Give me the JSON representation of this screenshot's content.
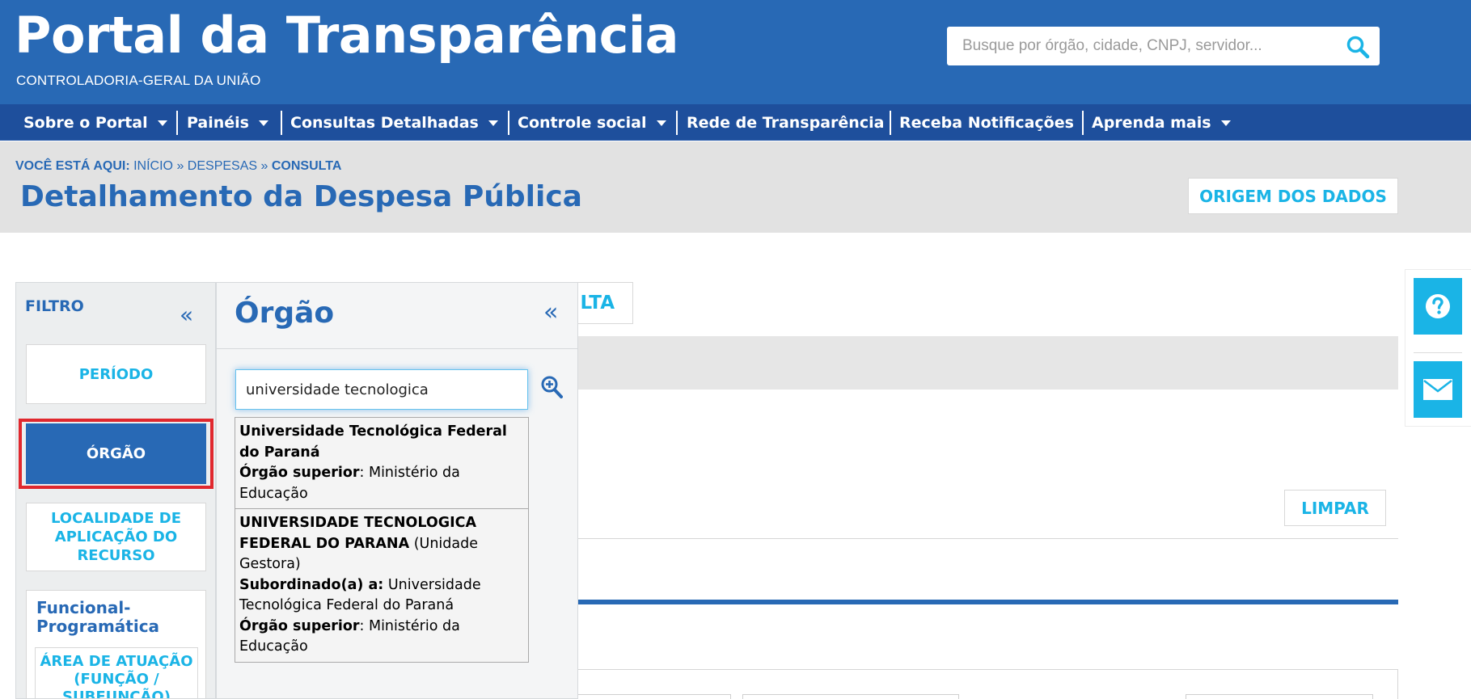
{
  "header": {
    "title": "Portal da Transparência",
    "subtitle": "CONTROLADORIA-GERAL DA UNIÃO",
    "search_placeholder": "Busque por órgão, cidade, CNPJ, servidor..."
  },
  "nav": {
    "items": [
      {
        "label": "Sobre o Portal",
        "dropdown": true
      },
      {
        "label": "Painéis",
        "dropdown": true
      },
      {
        "label": "Consultas Detalhadas",
        "dropdown": true
      },
      {
        "label": "Controle social",
        "dropdown": true
      },
      {
        "label": "Rede de Transparência",
        "dropdown": false
      },
      {
        "label": "Receba Notificações",
        "dropdown": false
      },
      {
        "label": "Aprenda mais",
        "dropdown": true
      }
    ]
  },
  "breadcrumb": {
    "prefix": "VOCÊ ESTÁ AQUI:",
    "home": "INÍCIO",
    "sep1": "»",
    "section": "DESPESAS",
    "sep2": "»",
    "current": "CONSULTA"
  },
  "page": {
    "title": "Detalhamento da Despesa Pública",
    "origem_label": "ORIGEM DOS DADOS"
  },
  "filter": {
    "title": "FILTRO",
    "collapse_glyph": "«",
    "periodo_label": "PERÍODO",
    "orgao_label": "ÓRGÃO",
    "localidade_label": "LOCALIDADE DE APLICAÇÃO DO RECURSO",
    "funcional_title": "Funcional-Programática",
    "area_label": "ÁREA DE ATUAÇÃO (FUNÇÃO / SUBFUNÇÃO)"
  },
  "main": {
    "consulta_partial": "LTA",
    "limpar_label": "LIMPAR"
  },
  "orgao_panel": {
    "title": "Órgão",
    "collapse_glyph": "«",
    "search_value": "universidade tecnologica",
    "suggestions": [
      {
        "name": "Universidade Tecnológica Federal do Paraná",
        "superior_label": "Órgão superior",
        "superior_value": ": Ministério da Educação"
      },
      {
        "name": "UNIVERSIDADE TECNOLOGICA FEDERAL DO PARANA",
        "type": " (Unidade Gestora)",
        "sub_label": "Subordinado(a) a:",
        "sub_value": " Universidade Tecnológica Federal do Paraná",
        "superior_label": "Órgão superior",
        "superior_value": ": Ministério da Educação"
      }
    ]
  },
  "floating": {
    "help_icon": "question-icon",
    "mail_icon": "mail-icon"
  },
  "colors": {
    "header_blue": "#2869b5",
    "nav_blue": "#1e4f9c",
    "accent_cyan": "#1ab4e6",
    "highlight_red": "#e0282e"
  }
}
